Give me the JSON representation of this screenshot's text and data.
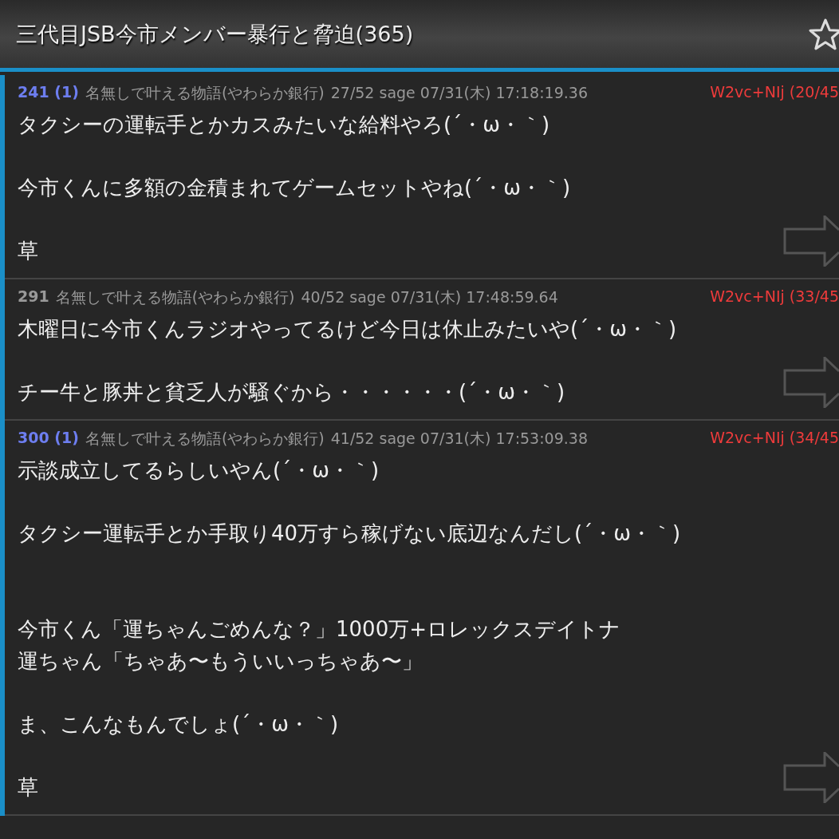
{
  "header": {
    "title": "三代目JSB今市メンバー暴行と脅迫(365)",
    "favorite": false
  },
  "posts": [
    {
      "number": "241",
      "replies": "(1)",
      "name": "名無しで叶える物語",
      "trip": "(やわらか銀行)",
      "meta": "27/52 sage 07/31(木) 17:18:19.36",
      "id": "W2vc+NIj (20/45",
      "sections": [
        [
          [
            "タクシーの運転手とかカスみたいな給料やろ(´・ω・｀)"
          ],
          [
            "今市くんに多額の金積まれてゲームセットやね(´・ω・｀)"
          ],
          [
            "草"
          ]
        ]
      ]
    },
    {
      "number": "291",
      "name": "名無しで叶える物語",
      "trip": "(やわらか銀行)",
      "meta": "40/52 sage 07/31(木) 17:48:59.64",
      "id": "W2vc+NIj (33/45",
      "sections": [
        [
          [
            "木曜日に今市くんラジオやってるけど今日は休止みたいや(´・ω・｀)"
          ],
          [
            "チー牛と豚丼と貧乏人が騒ぐから・・・・・・(´・ω・｀)"
          ]
        ]
      ]
    },
    {
      "number": "300",
      "replies": "(1)",
      "name": "名無しで叶える物語",
      "trip": "(やわらか銀行)",
      "meta": "41/52 sage 07/31(木) 17:53:09.38",
      "id": "W2vc+NIj (34/45",
      "sections": [
        [
          [
            "示談成立してるらしいやん(´・ω・｀)"
          ],
          [
            "タクシー運転手とか手取り40万すら稼げない底辺なんだし(´・ω・｀)"
          ]
        ],
        [
          [
            "今市くん「運ちゃんごめんな？」1000万+ロレックスデイトナ",
            "運ちゃん「ちゃあ〜もういいっちゃあ〜」"
          ],
          [
            "ま、こんなもんでしょ(´・ω・｀)"
          ],
          [
            "草"
          ]
        ]
      ]
    }
  ]
}
